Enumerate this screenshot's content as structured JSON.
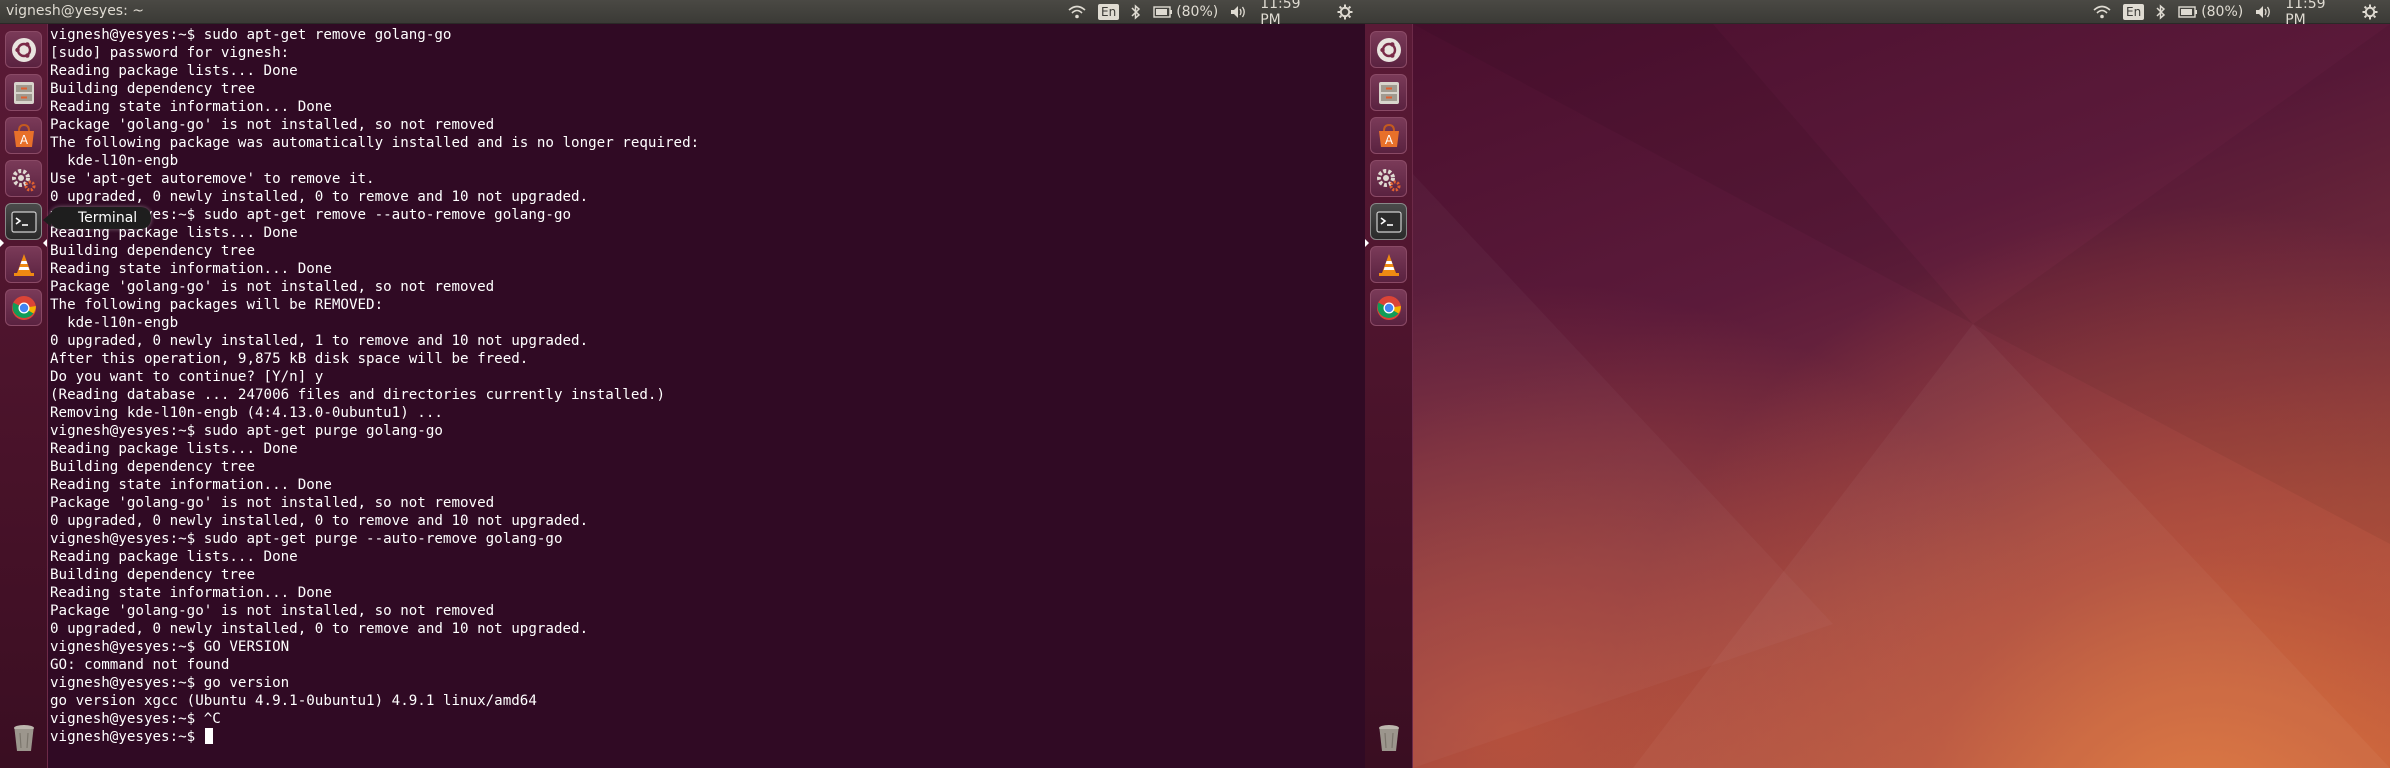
{
  "panel": {
    "window_title": "vignesh@yesyes: ~",
    "keyboard_layout": "En",
    "battery_text": "(80%)",
    "clock": "11:59 PM",
    "icons": [
      "wifi-icon",
      "bluetooth-icon",
      "battery-icon",
      "volume-icon",
      "gear-icon"
    ]
  },
  "launcher": {
    "items": [
      "dash-home",
      "files",
      "ubuntu-software-center",
      "system-settings",
      "terminal",
      "vlc",
      "chrome"
    ],
    "tooltip": "Terminal",
    "trash": "trash"
  },
  "terminal": {
    "lines": [
      "vignesh@yesyes:~$ sudo apt-get remove golang-go",
      "[sudo] password for vignesh:",
      "Reading package lists... Done",
      "Building dependency tree",
      "Reading state information... Done",
      "Package 'golang-go' is not installed, so not removed",
      "The following package was automatically installed and is no longer required:",
      "  kde-l10n-engb",
      "Use 'apt-get autoremove' to remove it.",
      "0 upgraded, 0 newly installed, 0 to remove and 10 not upgraded.",
      "vignesh@yesyes:~$ sudo apt-get remove --auto-remove golang-go",
      "Reading package lists... Done",
      "Building dependency tree",
      "Reading state information... Done",
      "Package 'golang-go' is not installed, so not removed",
      "The following packages will be REMOVED:",
      "  kde-l10n-engb",
      "0 upgraded, 0 newly installed, 1 to remove and 10 not upgraded.",
      "After this operation, 9,875 kB disk space will be freed.",
      "Do you want to continue? [Y/n] y",
      "(Reading database ... 247006 files and directories currently installed.)",
      "Removing kde-l10n-engb (4:4.13.0-0ubuntu1) ...",
      "vignesh@yesyes:~$ sudo apt-get purge golang-go",
      "Reading package lists... Done",
      "Building dependency tree",
      "Reading state information... Done",
      "Package 'golang-go' is not installed, so not removed",
      "0 upgraded, 0 newly installed, 0 to remove and 10 not upgraded.",
      "vignesh@yesyes:~$ sudo apt-get purge --auto-remove golang-go",
      "Reading package lists... Done",
      "Building dependency tree",
      "Reading state information... Done",
      "Package 'golang-go' is not installed, so not removed",
      "0 upgraded, 0 newly installed, 0 to remove and 10 not upgraded.",
      "vignesh@yesyes:~$ GO VERSION",
      "GO: command not found",
      "vignesh@yesyes:~$ go version",
      "go version xgcc (Ubuntu 4.9.1-0ubuntu1) 4.9.1 linux/amd64",
      "vignesh@yesyes:~$ ^C",
      "vignesh@yesyes:~$ "
    ]
  },
  "colors": {
    "terminal_bg": "#300a24",
    "terminal_fg": "#ffffff",
    "panel_bg": "#3b3a36"
  }
}
